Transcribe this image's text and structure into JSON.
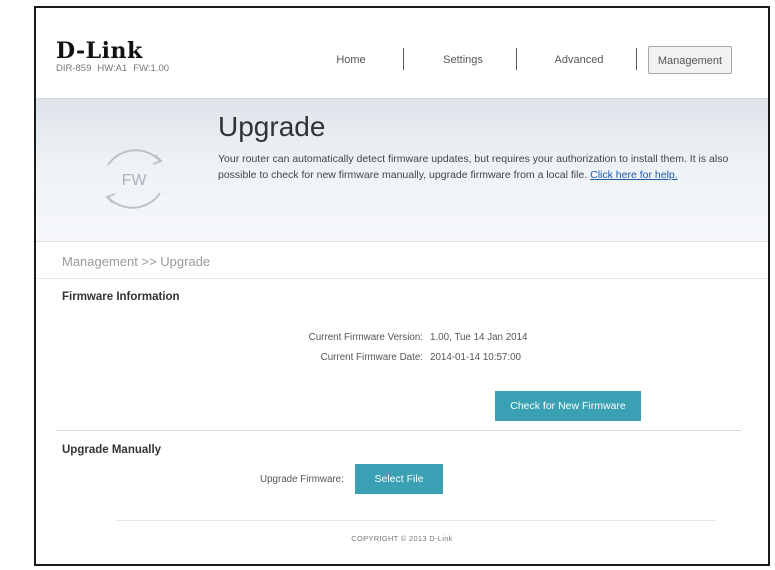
{
  "brand": {
    "name": "D-Link",
    "model": "DIR-859",
    "hw": "HW:A1",
    "fw": "FW:1.00"
  },
  "nav": [
    {
      "label": "Home"
    },
    {
      "label": "Settings"
    },
    {
      "label": "Advanced"
    },
    {
      "label": "Management",
      "active": true
    }
  ],
  "banner": {
    "icon": "firmware-refresh-icon",
    "icon_text": "FW",
    "title": "Upgrade",
    "description": "Your router can automatically detect firmware updates, but requires your authorization to install them. It is also possible to check for new firmware manually, upgrade firmware from a local file.",
    "help_link": "Click here for help."
  },
  "breadcrumb": "Management >> Upgrade",
  "firmware_info": {
    "title": "Firmware Information",
    "version_label": "Current Firmware Version:",
    "version_value": "1.00, Tue 14 Jan 2014",
    "date_label": "Current Firmware Date:",
    "date_value": "2014-01-14 10:57:00",
    "check_button": "Check for New Firmware"
  },
  "manual": {
    "title": "Upgrade Manually",
    "upgrade_label": "Upgrade Firmware:",
    "select_button": "Select File"
  },
  "footer": {
    "copyright": "COPYRIGHT © 2013 D-Link"
  },
  "colors": {
    "accent": "#3aa0b3",
    "link": "#1d5aa8"
  }
}
